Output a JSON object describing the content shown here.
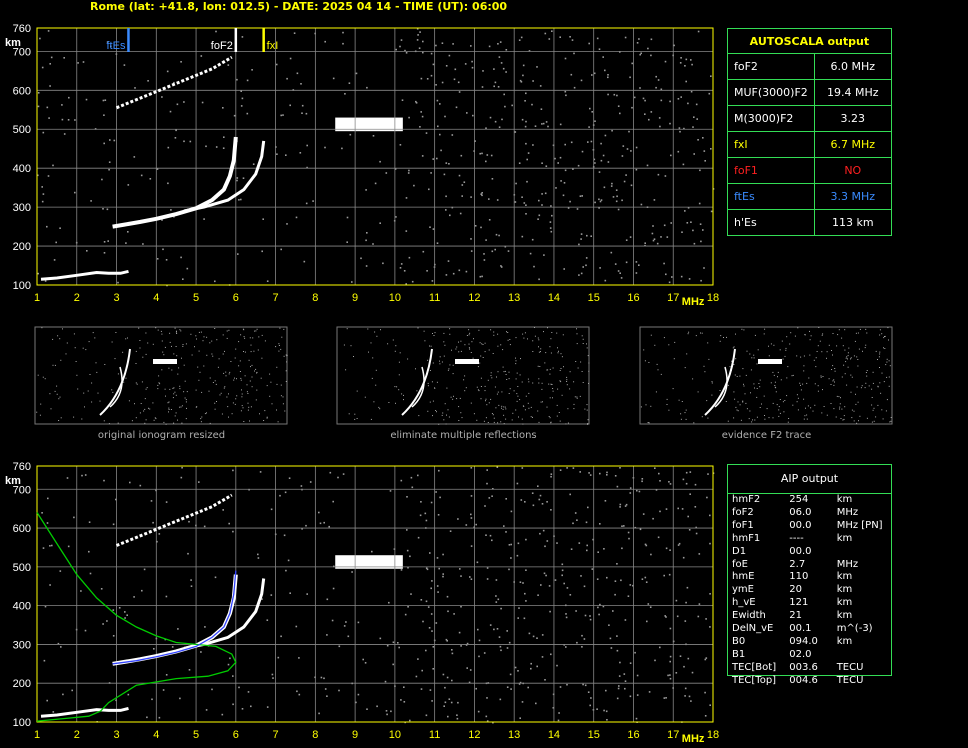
{
  "header": {
    "title": "Rome (lat: +41.8, lon: 012.5) - DATE: 2025 04 14 - TIME (UT): 06:00"
  },
  "autoscala": {
    "title": "AUTOSCALA output",
    "rows": [
      {
        "key": "foF2",
        "value": "6.0 MHz",
        "color": "#ffffff"
      },
      {
        "key": "MUF(3000)F2",
        "value": "19.4 MHz",
        "color": "#ffffff"
      },
      {
        "key": "M(3000)F2",
        "value": "3.23",
        "color": "#ffffff"
      },
      {
        "key": "fxI",
        "value": "6.7 MHz",
        "color": "#ffff00"
      },
      {
        "key": "foF1",
        "value": "NO",
        "color": "#ff2020"
      },
      {
        "key": "ftEs",
        "value": "3.3 MHz",
        "color": "#3a8bff"
      },
      {
        "key": "h'Es",
        "value": "113    km",
        "color": "#ffffff"
      }
    ]
  },
  "aip": {
    "title": "AIP output",
    "rows": [
      [
        "hmF2",
        "254",
        "km"
      ],
      [
        "foF2",
        "06.0",
        "MHz"
      ],
      [
        "foF1",
        "00.0",
        "MHz   [PN]"
      ],
      [
        "hmF1",
        "----",
        "km"
      ],
      [
        "D1",
        "00.0",
        ""
      ],
      [
        "foE",
        "2.7",
        "MHz"
      ],
      [
        "hmE",
        "110",
        "km"
      ],
      [
        "ymE",
        "20",
        "km"
      ],
      [
        "h_vE",
        "121",
        "km"
      ],
      [
        "Ewidth",
        "21",
        "km"
      ],
      [
        "DelN_vE",
        "00.1",
        "m^(-3)"
      ],
      [
        "B0",
        "094.0",
        "km"
      ],
      [
        "B1",
        "02.0",
        ""
      ],
      [
        "TEC[Bot]",
        "003.6",
        "TECU"
      ],
      [
        "TEC[Top]",
        "004.6",
        "TECU"
      ]
    ]
  },
  "thumbnails": {
    "captions": [
      "original ionogram resized",
      "eliminate multiple reflections",
      "evidence F2 trace"
    ]
  },
  "colors": {
    "grid": "#888888",
    "frame": "#ffff00",
    "ftEs": "#3a8bff",
    "foF2": "#ffffff",
    "fxI": "#ffff00",
    "profile": "#00cc00",
    "fit": "#3344ff"
  },
  "chart_data": [
    {
      "type": "scatter",
      "name": "autoscala-ionogram",
      "xlabel": "MHz",
      "ylabel": "km",
      "x_ticks": [
        1,
        2,
        3,
        4,
        5,
        6,
        7,
        8,
        9,
        10,
        11,
        12,
        13,
        14,
        15,
        16,
        17,
        18
      ],
      "y_ticks": [
        100,
        200,
        300,
        400,
        500,
        600,
        700,
        760
      ],
      "xlim": [
        1,
        18
      ],
      "ylim": [
        100,
        760
      ],
      "grid": true,
      "markers": [
        {
          "label": "ftEs",
          "x": 3.3,
          "color": "#3a8bff"
        },
        {
          "label": "foF2",
          "x": 6.0,
          "color": "#ffffff"
        },
        {
          "label": "fxI",
          "x": 6.7,
          "color": "#ffff00"
        }
      ],
      "traces": {
        "o_trace": [
          [
            2.9,
            250
          ],
          [
            3.2,
            255
          ],
          [
            3.6,
            262
          ],
          [
            4.0,
            270
          ],
          [
            4.5,
            282
          ],
          [
            5.0,
            297
          ],
          [
            5.4,
            318
          ],
          [
            5.7,
            345
          ],
          [
            5.85,
            380
          ],
          [
            5.95,
            420
          ],
          [
            6.0,
            480
          ]
        ],
        "x_trace": [
          [
            4.7,
            290
          ],
          [
            5.2,
            300
          ],
          [
            5.8,
            318
          ],
          [
            6.2,
            345
          ],
          [
            6.5,
            385
          ],
          [
            6.65,
            430
          ],
          [
            6.7,
            470
          ]
        ],
        "multiple": [
          [
            3.0,
            555
          ],
          [
            3.6,
            580
          ],
          [
            4.2,
            605
          ],
          [
            4.8,
            630
          ],
          [
            5.4,
            655
          ],
          [
            5.9,
            685
          ]
        ],
        "es": [
          [
            1.1,
            115
          ],
          [
            1.5,
            118
          ],
          [
            2.0,
            125
          ],
          [
            2.5,
            132
          ],
          [
            2.8,
            130
          ],
          [
            3.1,
            130
          ],
          [
            3.3,
            135
          ]
        ]
      }
    },
    {
      "type": "line",
      "name": "aip-ionogram",
      "xlabel": "MHz",
      "ylabel": "km",
      "x_ticks": [
        1,
        2,
        3,
        4,
        5,
        6,
        7,
        8,
        9,
        10,
        11,
        12,
        13,
        14,
        15,
        16,
        17,
        18
      ],
      "y_ticks": [
        100,
        200,
        300,
        400,
        500,
        600,
        700,
        760
      ],
      "xlim": [
        1,
        18
      ],
      "ylim": [
        100,
        760
      ],
      "grid": true,
      "series": [
        {
          "values": [
            [
              1.0,
              640
            ],
            [
              1.5,
              560
            ],
            [
              2.0,
              480
            ],
            [
              2.5,
              420
            ],
            [
              3.0,
              375
            ],
            [
              3.5,
              345
            ],
            [
              4.0,
              322
            ],
            [
              4.5,
              305
            ],
            [
              5.0,
              300
            ],
            [
              5.5,
              295
            ],
            [
              5.9,
              275
            ],
            [
              6.0,
              254
            ],
            [
              5.8,
              232
            ],
            [
              5.3,
              218
            ],
            [
              4.5,
              212
            ],
            [
              3.5,
              195
            ],
            [
              2.8,
              150
            ],
            [
              2.6,
              128
            ],
            [
              2.3,
              115
            ],
            [
              1.8,
              110
            ],
            [
              1.2,
              104
            ],
            [
              1.0,
              102
            ]
          ],
          "color": "#00cc00"
        },
        {
          "values": [
            [
              2.9,
              250
            ],
            [
              3.5,
              258
            ],
            [
              4.0,
              268
            ],
            [
              4.5,
              280
            ],
            [
              5.0,
              295
            ],
            [
              5.4,
              318
            ],
            [
              5.7,
              345
            ],
            [
              5.85,
              380
            ],
            [
              5.95,
              430
            ],
            [
              6.0,
              490
            ]
          ],
          "color": "#3344ff"
        }
      ]
    }
  ]
}
